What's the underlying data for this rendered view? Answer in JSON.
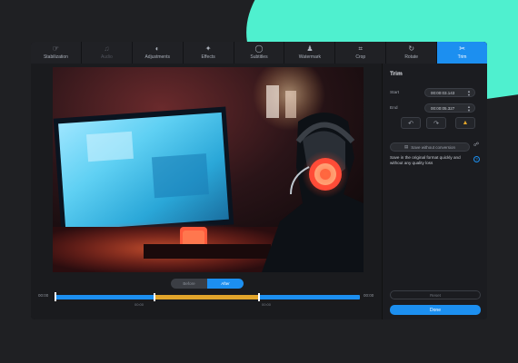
{
  "toolbar": {
    "tools": [
      {
        "label": "Stabilization",
        "icon": "stabilization-icon",
        "state": "normal"
      },
      {
        "label": "Audio",
        "icon": "music-note-icon",
        "state": "disabled"
      },
      {
        "label": "Adjustments",
        "icon": "contrast-icon",
        "state": "normal"
      },
      {
        "label": "Effects",
        "icon": "magic-wand-icon",
        "state": "normal"
      },
      {
        "label": "Subtitles",
        "icon": "speech-bubble-icon",
        "state": "normal"
      },
      {
        "label": "Watermark",
        "icon": "stamp-icon",
        "state": "normal"
      },
      {
        "label": "Crop",
        "icon": "crop-icon",
        "state": "normal"
      },
      {
        "label": "Rotate",
        "icon": "rotate-icon",
        "state": "normal"
      },
      {
        "label": "Trim",
        "icon": "scissors-icon",
        "state": "active"
      }
    ]
  },
  "preview": {
    "toggle": {
      "before": "Before",
      "after": "After",
      "selected": "After"
    },
    "time_start": "00:00",
    "time_end": "00:00",
    "selection_start": "00:00",
    "selection_end": "00:00"
  },
  "trim": {
    "title": "Trim",
    "start_label": "Start",
    "start_value": "00:00:03.143",
    "end_label": "End",
    "end_value": "00:00:05.327",
    "save_button": "Save without conversion",
    "info_text": "Save in the original format quickly and without any quality loss",
    "reset_button": "Reset",
    "done_button": "Done"
  },
  "colors": {
    "accent": "#1c8ff0",
    "selection": "#e2a52b",
    "mint": "#4ff0cf"
  }
}
